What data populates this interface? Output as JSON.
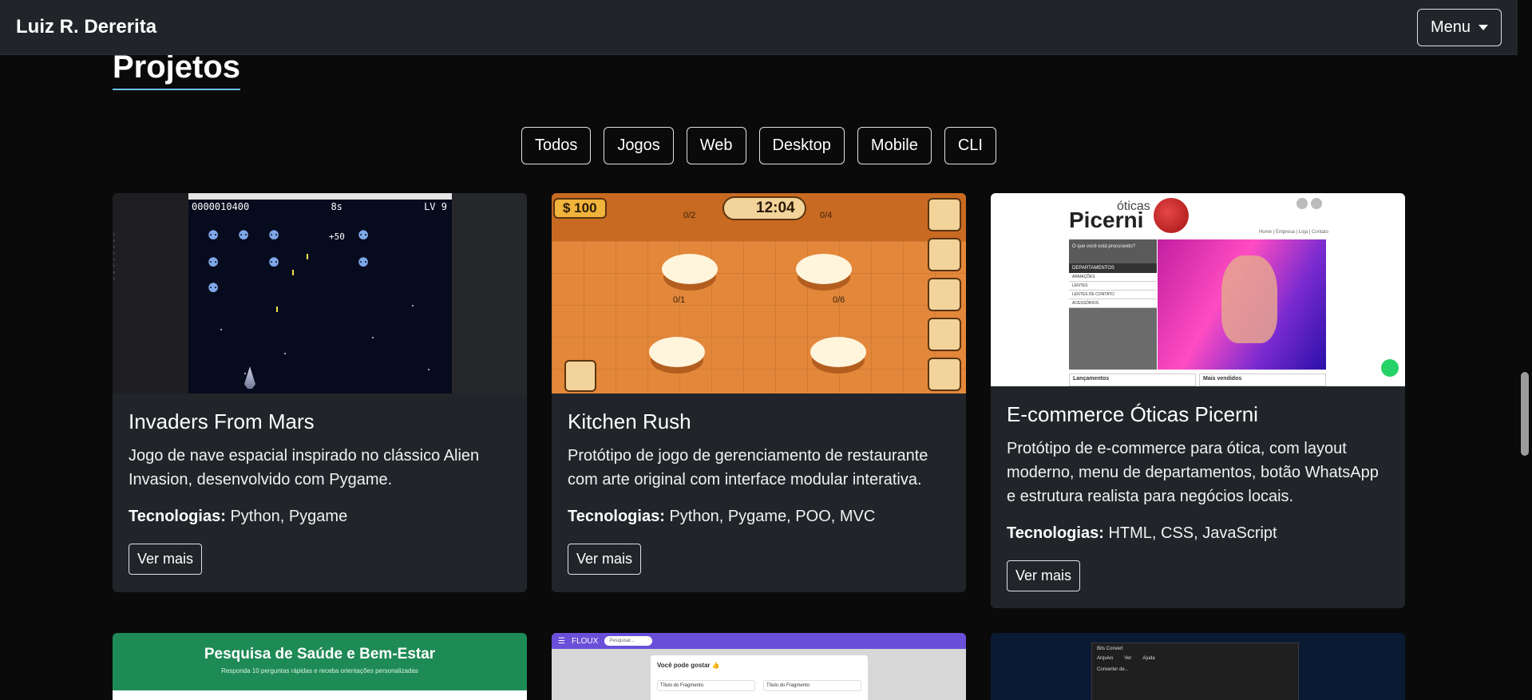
{
  "header": {
    "brand": "Luiz R. Dererita",
    "menu_label": "Menu"
  },
  "section": {
    "title": "Projetos"
  },
  "filters": [
    "Todos",
    "Jogos",
    "Web",
    "Desktop",
    "Mobile",
    "CLI"
  ],
  "tech_label": "Tecnologias:",
  "more_label": "Ver mais",
  "projects": [
    {
      "title": "Invaders From Mars",
      "description": "Jogo de nave espacial inspirado no clássico Alien Invasion, desenvolvido com Pygame.",
      "tech": "Python, Pygame",
      "image": {
        "score": "0000010400",
        "timer": "8s",
        "level": "LV 9",
        "bonus": "+50"
      }
    },
    {
      "title": "Kitchen Rush",
      "description": "Protótipo de jogo de gerenciamento de restaurante com arte original com interface modular interativa.",
      "tech": "Python, Pygame, POO, MVC",
      "image": {
        "money": "$ 100",
        "clock": "12:04",
        "table_labels": [
          "0/2",
          "0/4",
          "0/1",
          "0/6"
        ]
      }
    },
    {
      "title": "E-commerce Óticas Picerni",
      "description": "Protótipo de e-commerce para ótica, com layout moderno, menu de departamentos, botão WhatsApp e estrutura realista para negócios locais.",
      "tech": "HTML, CSS, JavaScript",
      "image": {
        "logo_small": "óticas",
        "logo": "Picerni",
        "nav": "Home | Empresa | Loja | Contato",
        "search_placeholder": "O que você está procurando?",
        "departments_label": "DEPARTAMENTOS",
        "departments": [
          "ARMAÇÕES",
          "LENTES",
          "LENTES DE CONTATO",
          "ACESSÓRIOS"
        ],
        "bottom_left": "Lançamentos",
        "bottom_right": "Mais vendidos"
      }
    }
  ],
  "row2": {
    "health_title": "Pesquisa de Saúde e Bem-Estar",
    "health_subtitle": "Responda 10 perguntas rápidas e receba orientações personalizadas",
    "floux_brand": "FLOUX",
    "floux_search": "Pesquisar...",
    "floux_heading": "Você pode gostar 👍",
    "floux_item": "Título do Fragmento",
    "dark_title": "Bits Convert",
    "dark_menu": [
      "Arquivo",
      "Ver",
      "Ajuda"
    ],
    "dark_label": "Converter de..."
  }
}
